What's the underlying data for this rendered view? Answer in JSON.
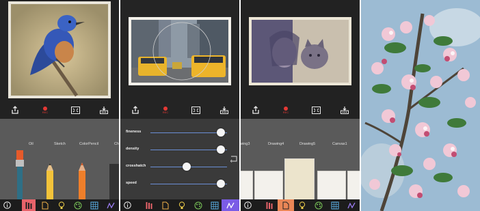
{
  "colors": {
    "accent_red": "#e8636a",
    "accent_orange": "#ea8656",
    "accent_purple": "#7b5ce6",
    "slider_track": "#6b8fd6"
  },
  "toolbar_icons": [
    "share-icon",
    "record-icon",
    "fullscreen-icon",
    "more-icon"
  ],
  "rec_label": "REC",
  "panel1": {
    "tools": [
      {
        "label": "Oil"
      },
      {
        "label": "Sketch"
      },
      {
        "label": "ColorPencil"
      },
      {
        "label": "Ch"
      }
    ]
  },
  "panel2": {
    "sliders": [
      {
        "label": "fineness",
        "value": 0.92
      },
      {
        "label": "density",
        "value": 0.92
      },
      {
        "label": "crosshatch",
        "value": 0.47
      },
      {
        "label": "speed",
        "value": 0.92
      }
    ]
  },
  "panel3": {
    "papers": [
      {
        "label": "awing3"
      },
      {
        "label": "Drawing4"
      },
      {
        "label": "Drawing5"
      },
      {
        "label": "Canvas1"
      }
    ]
  },
  "tabbar_icons": [
    "info-icon",
    "brush-icon",
    "paper-icon",
    "bulb-icon",
    "palette-icon",
    "grid-icon",
    "stroke-icon"
  ]
}
